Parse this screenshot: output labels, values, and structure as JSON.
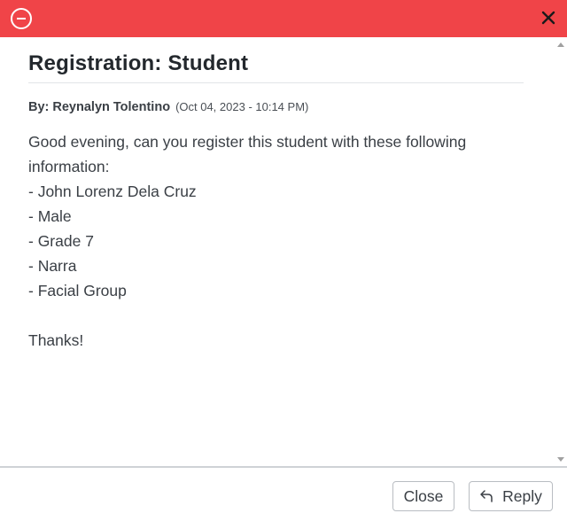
{
  "dialog": {
    "header_icon": "minus-circle-icon",
    "close_icon": "close-icon"
  },
  "message": {
    "title": "Registration: Student",
    "author": "By: Reynalyn Tolentino",
    "timestamp": "(Oct 04, 2023 - 10:14 PM)",
    "body_lines": [
      "Good evening, can you register this student with these following",
      "information:",
      "- John Lorenz Dela Cruz",
      "- Male",
      "- Grade 7",
      "- Narra",
      "- Facial Group",
      "",
      "Thanks!"
    ]
  },
  "footer": {
    "close_label": "Close",
    "reply_label": "Reply",
    "reply_icon": "reply-arrow-icon"
  },
  "colors": {
    "header_bg": "#f04448",
    "text": "#3a3f45",
    "title": "#23282d"
  }
}
